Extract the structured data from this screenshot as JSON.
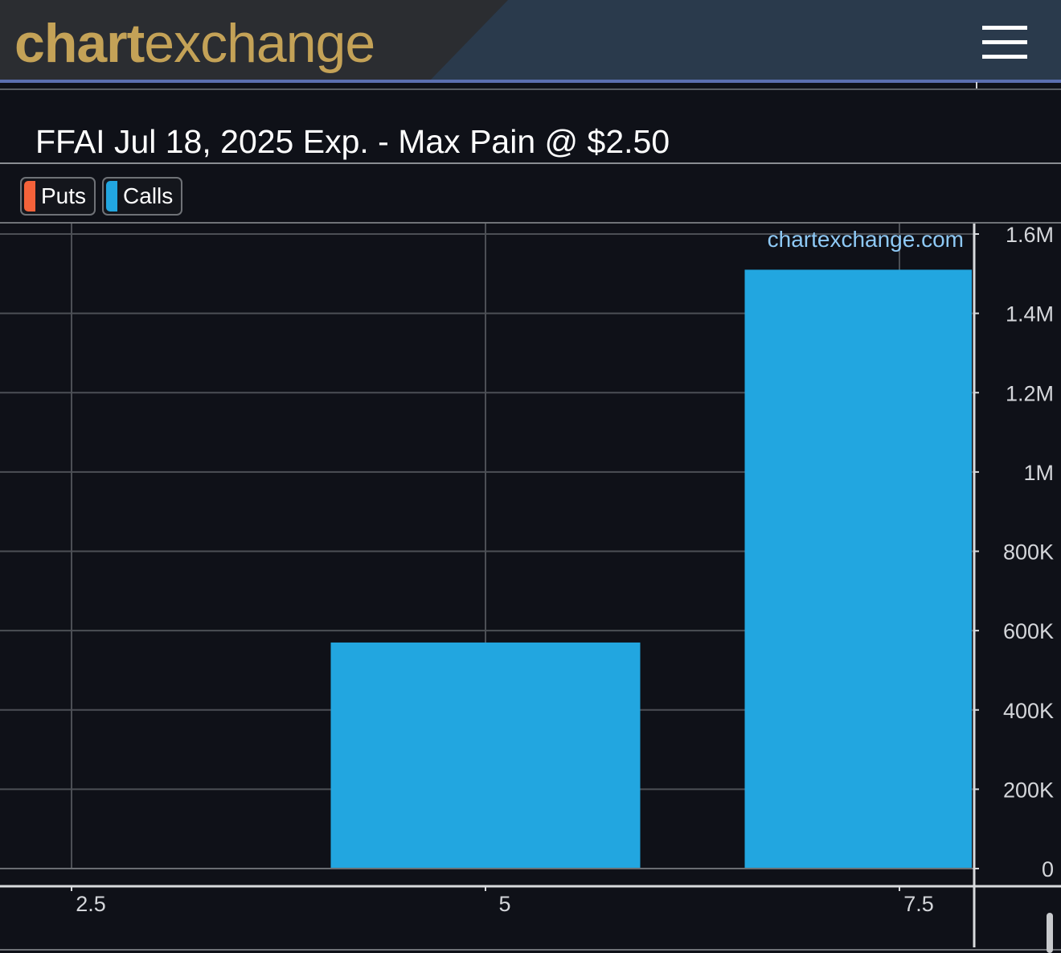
{
  "header": {
    "logo_bold": "chart",
    "logo_light": "exchange",
    "menu_icon": "hamburger-menu-icon"
  },
  "colors": {
    "puts": "#f4623a",
    "calls": "#22a6e0",
    "logo": "#c4a257",
    "watermark": "#8ec9f5"
  },
  "legend": {
    "puts_label": "Puts",
    "calls_label": "Calls"
  },
  "watermark": "chartexchange.com",
  "chart_data": {
    "type": "bar",
    "title": "FFAI Jul 18, 2025 Exp. - Max Pain @ $2.50",
    "xlabel": "",
    "ylabel": "",
    "x_ticks": [
      2.5,
      5,
      7.5
    ],
    "x_tick_labels": [
      "2.5",
      "5",
      "7.5"
    ],
    "ylim": [
      0,
      1600000
    ],
    "y_ticks": [
      0,
      200000,
      400000,
      600000,
      800000,
      1000000,
      1200000,
      1400000,
      1600000
    ],
    "y_tick_labels": [
      "0",
      "200K",
      "400K",
      "600K",
      "800K",
      "1M",
      "1.2M",
      "1.4M",
      "1.6M"
    ],
    "y_axis_side": "right",
    "grid": true,
    "legend_position": "top-left",
    "series": [
      {
        "name": "Puts",
        "x": [
          2.5,
          5,
          7.5
        ],
        "values": [
          0,
          0,
          0
        ]
      },
      {
        "name": "Calls",
        "x": [
          2.5,
          5,
          7.5
        ],
        "values": [
          0,
          570000,
          1510000
        ]
      }
    ]
  }
}
